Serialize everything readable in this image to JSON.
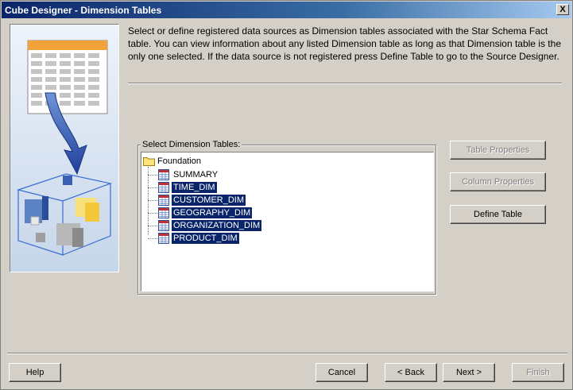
{
  "window": {
    "title": "Cube Designer - Dimension Tables",
    "close_label": "X"
  },
  "description": "Select or define registered data sources as Dimension tables associated with the Star Schema Fact table.  You can view information about any listed Dimension table as long as that Dimension table is the only one selected.  If the data source is not registered press Define Table to go to the Source Designer.",
  "dimension_group": {
    "label": "Select Dimension Tables:",
    "root": "Foundation",
    "items": [
      {
        "label": "SUMMARY",
        "selected": false
      },
      {
        "label": "TIME_DIM",
        "selected": true
      },
      {
        "label": "CUSTOMER_DIM",
        "selected": true
      },
      {
        "label": "GEOGRAPHY_DIM",
        "selected": true
      },
      {
        "label": "ORGANIZATION_DIM",
        "selected": true
      },
      {
        "label": "PRODUCT_DIM",
        "selected": true
      }
    ]
  },
  "side_buttons": {
    "table_properties": "Table Properties",
    "column_properties": "Column Properties",
    "define_table": "Define Table"
  },
  "footer": {
    "help": "Help",
    "cancel": "Cancel",
    "back": "< Back",
    "next": "Next >",
    "finish": "Finish"
  },
  "colors": {
    "selection": "#0a246a",
    "face": "#d4d0c8",
    "title_start": "#0a246a",
    "title_end": "#a6caf0"
  }
}
